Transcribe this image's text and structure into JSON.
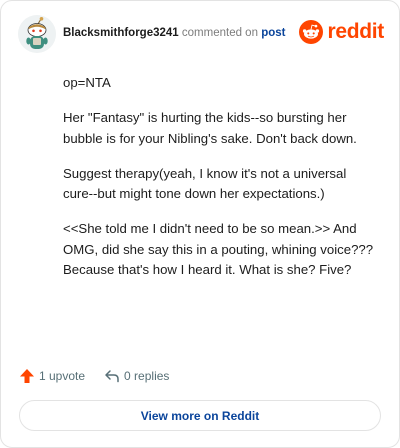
{
  "comment": {
    "author": "Blacksmithforge3241",
    "verb": "commented on",
    "post_link": "post",
    "brand": "reddit",
    "paragraphs": [
      "op=NTA",
      "Her \"Fantasy\" is hurting the kids--so bursting her bubble is for your Nibling's sake. Don't back down.",
      "Suggest therapy(yeah, I know it's not a universal cure--but might tone down her expectations.)",
      "<<She told me I didn't need to be so mean.>> And OMG, did she say this in a pouting, whining voice??? Because that's how I heard it. What is she? Five?"
    ]
  },
  "actions": {
    "upvote_label": "1 upvote",
    "replies_label": "0 replies"
  },
  "footer": {
    "view_more_label": "View more on Reddit"
  },
  "colors": {
    "brand": "#ff4500",
    "link": "#0a449b",
    "muted": "#7c7c7c"
  },
  "icons": {
    "avatar": "snoo-avatar",
    "brand": "reddit-logo-icon",
    "upvote": "upvote-arrow-icon",
    "reply": "reply-arrow-icon"
  }
}
